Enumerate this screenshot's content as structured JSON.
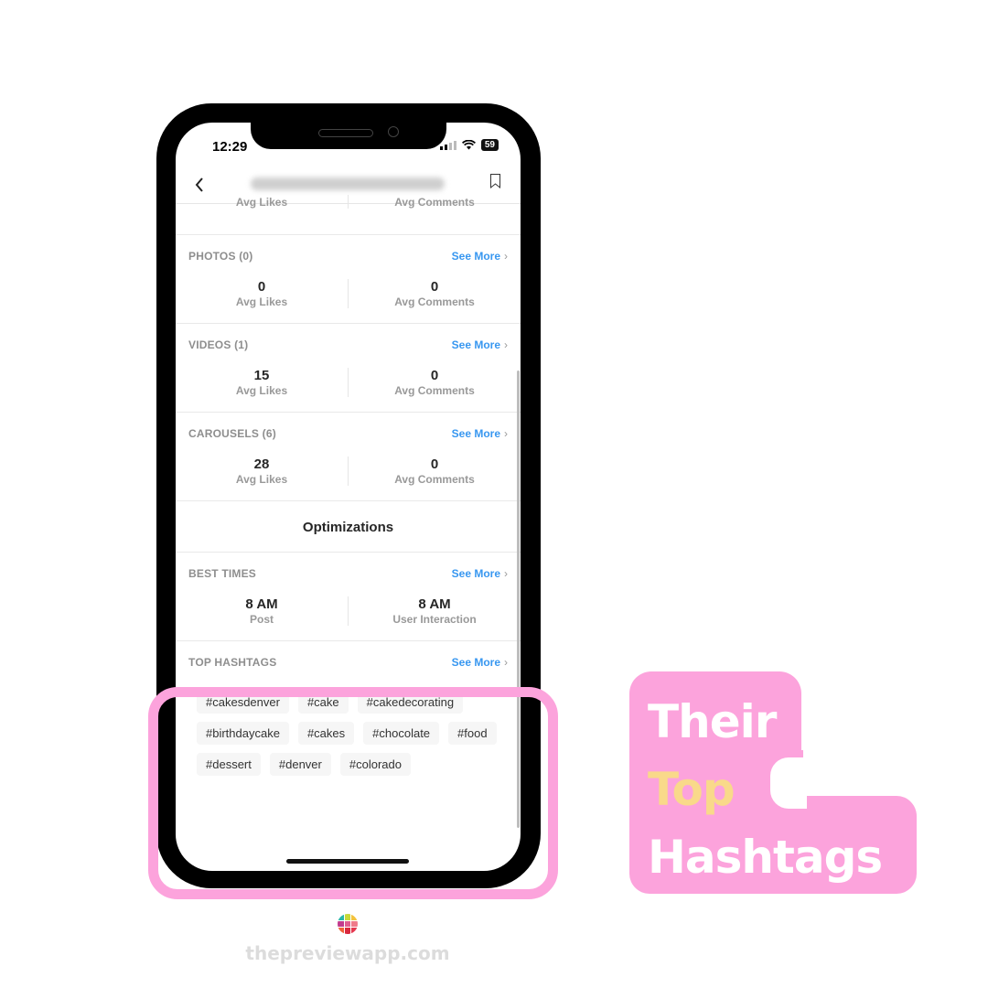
{
  "status_bar": {
    "time": "12:29",
    "battery": "59"
  },
  "nav": {
    "back_icon": "chevron-left-icon",
    "bookmark_icon": "bookmark-icon"
  },
  "top_partial": {
    "left_label": "Avg Likes",
    "right_label": "Avg Comments"
  },
  "sections": [
    {
      "title": "PHOTOS (0)",
      "see_more": "See More",
      "left_value": "0",
      "left_label": "Avg Likes",
      "right_value": "0",
      "right_label": "Avg Comments"
    },
    {
      "title": "VIDEOS (1)",
      "see_more": "See More",
      "left_value": "15",
      "left_label": "Avg Likes",
      "right_value": "0",
      "right_label": "Avg Comments"
    },
    {
      "title": "CAROUSELS (6)",
      "see_more": "See More",
      "left_value": "28",
      "left_label": "Avg Likes",
      "right_value": "0",
      "right_label": "Avg Comments"
    }
  ],
  "optimizations": {
    "heading": "Optimizations"
  },
  "best_times": {
    "title": "BEST TIMES",
    "see_more": "See More",
    "left_value": "8 AM",
    "left_label": "Post",
    "right_value": "8 AM",
    "right_label": "User Interaction"
  },
  "top_hashtags": {
    "title": "TOP HASHTAGS",
    "see_more": "See More",
    "tags": [
      "#cakesdenver",
      "#cake",
      "#cakedecorating",
      "#birthdaycake",
      "#cakes",
      "#chocolate",
      "#food",
      "#dessert",
      "#denver",
      "#colorado"
    ]
  },
  "badge": {
    "line1": "Their",
    "line2": "Top",
    "line3": "Hashtags",
    "bg_color": "#fca3dc",
    "highlight_color": "#f9d98a"
  },
  "footer": {
    "site": "thepreviewapp.com"
  },
  "chevron": "›"
}
